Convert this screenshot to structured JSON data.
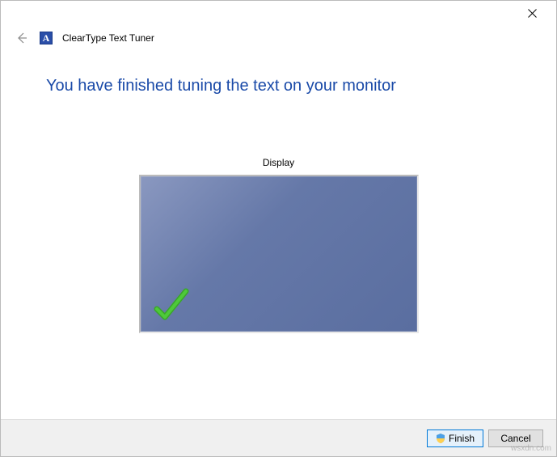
{
  "window": {
    "app_icon_letter": "A",
    "title": "ClearType Text Tuner"
  },
  "content": {
    "heading": "You have finished tuning the text on your monitor",
    "display_label": "Display"
  },
  "footer": {
    "finish_label": "Finish",
    "cancel_label": "Cancel"
  },
  "watermark": "wsxdn.com"
}
